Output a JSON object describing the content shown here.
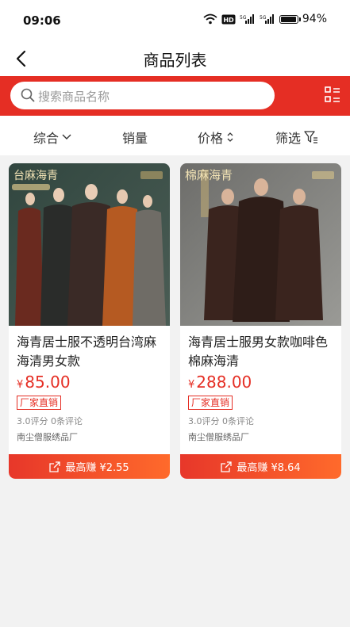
{
  "status": {
    "time": "09:06",
    "battery": "94%",
    "battery_level": 0.94,
    "net1": "HD",
    "net2": "5G",
    "net3": "5G"
  },
  "header": {
    "title": "商品列表"
  },
  "search": {
    "placeholder": "搜索商品名称"
  },
  "filters": [
    {
      "label": "综合"
    },
    {
      "label": "销量"
    },
    {
      "label": "价格"
    },
    {
      "label": "筛选"
    }
  ],
  "products": [
    {
      "image_text": "台麻海青",
      "title": "海青居士服不透明台湾麻海清男女款",
      "currency": "¥",
      "price": "85.00",
      "tag": "厂家直销",
      "rating": "3.0评分",
      "reviews": "0条评论",
      "shop": "南尘僧服绣品厂",
      "earn": "最高赚 ¥2.55"
    },
    {
      "image_text": "棉麻海青",
      "title": "海青居士服男女款咖啡色棉麻海清",
      "currency": "¥",
      "price": "288.00",
      "tag": "厂家直销",
      "rating": "3.0评分",
      "reviews": "0条评论",
      "shop": "南尘僧服绣品厂",
      "earn": "最高赚 ¥8.64"
    }
  ],
  "colors": {
    "accent": "#e52e24",
    "background": "#f2f2f2"
  }
}
